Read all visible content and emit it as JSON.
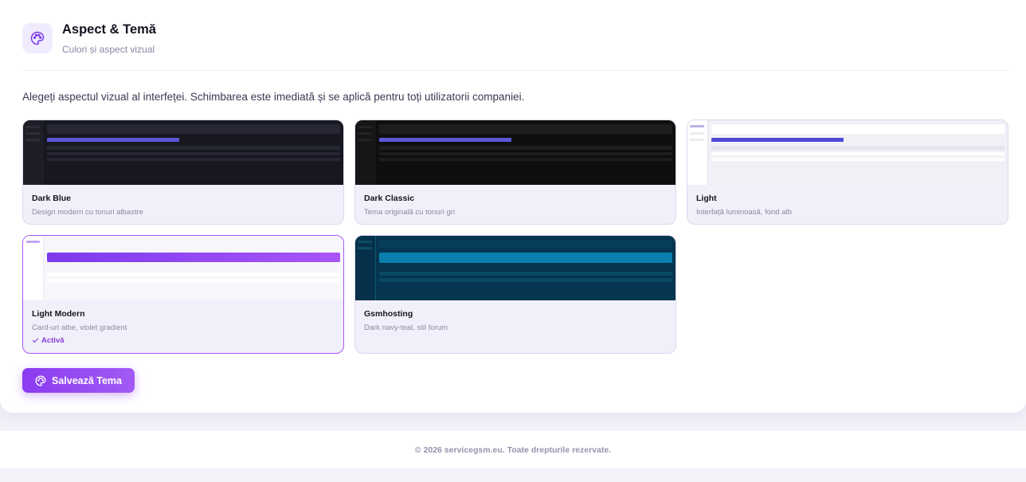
{
  "header": {
    "title": "Aspect & Temă",
    "subtitle": "Culori și aspect vizual",
    "icon": "palette-icon"
  },
  "description": "Alegeți aspectul vizual al interfeței. Schimbarea este imediată și se aplică pentru toți utilizatorii companiei.",
  "themes": [
    {
      "name": "Dark Blue",
      "description": "Design modern cu tonuri albastre",
      "active": false
    },
    {
      "name": "Dark Classic",
      "description": "Tema originală cu tonuri gri",
      "active": false
    },
    {
      "name": "Light",
      "description": "Interfață luminoasă, fond alb",
      "active": false
    },
    {
      "name": "Light Modern",
      "description": "Card-uri albe, violet gradient",
      "active": true,
      "active_label": "Activă"
    },
    {
      "name": "Gsmhosting",
      "description": "Dark navy-teal, stil forum",
      "active": false
    }
  ],
  "save_button": {
    "label": "Salvează Tema",
    "icon": "palette-icon"
  },
  "footer": {
    "text": "© 2026 servicegsm.eu. Toate drepturile rezervate."
  },
  "colors": {
    "accent": "#8b3cf0",
    "accent_light": "#f0ebfd"
  }
}
